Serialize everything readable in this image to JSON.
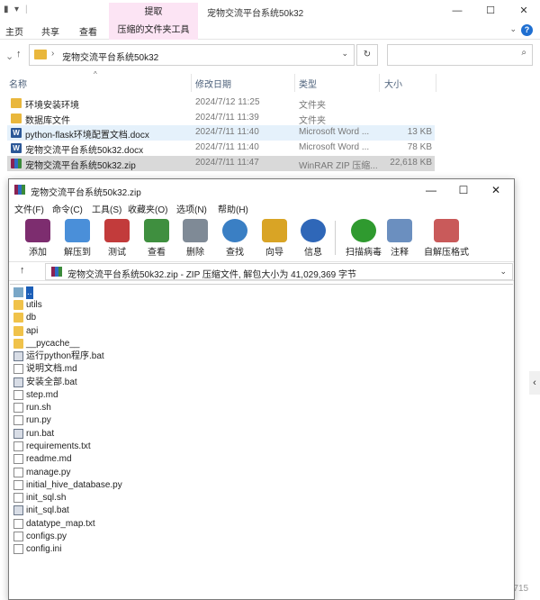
{
  "explorer": {
    "title": "宠物交流平台系统50k32",
    "context_tab_top": "提取",
    "ribbon_tabs": [
      "主页",
      "共享",
      "查看"
    ],
    "context_tab": "压缩的文件夹工具",
    "address_path": "宠物交流平台系统50k32",
    "columns": {
      "name": "名称",
      "date": "修改日期",
      "type": "类型",
      "size": "大小"
    },
    "files": [
      {
        "name": "环境安装环境",
        "date": "2024/7/12 11:25",
        "type": "文件夹",
        "size": "",
        "icon": "folder-icon"
      },
      {
        "name": "数据库文件",
        "date": "2024/7/11 11:39",
        "type": "文件夹",
        "size": "",
        "icon": "folder-icon"
      },
      {
        "name": "python-flask环境配置文档.docx",
        "date": "2024/7/11 11:40",
        "type": "Microsoft Word ...",
        "size": "13 KB",
        "icon": "word-doc-icon"
      },
      {
        "name": "宠物交流平台系统50k32.docx",
        "date": "2024/7/11 11:40",
        "type": "Microsoft Word ...",
        "size": "78 KB",
        "icon": "word-doc-icon"
      },
      {
        "name": "宠物交流平台系统50k32.zip",
        "date": "2024/7/11 11:47",
        "type": "WinRAR ZIP 压缩...",
        "size": "22,618 KB",
        "icon": "zip-archive-icon"
      }
    ]
  },
  "winrar": {
    "title": "宠物交流平台系统50k32.zip",
    "menu": [
      "文件(F)",
      "命令(C)",
      "工具(S)",
      "收藏夹(O)",
      "选项(N)",
      "帮助(H)"
    ],
    "toolbar": [
      {
        "label": "添加",
        "icon": "add-archive-icon",
        "color": "#7d2d6f"
      },
      {
        "label": "解压到",
        "icon": "extract-folder-icon",
        "color": "#4a8fd9"
      },
      {
        "label": "测试",
        "icon": "test-clipboard-icon",
        "color": "#c23b3b"
      },
      {
        "label": "查看",
        "icon": "view-book-icon",
        "color": "#3f8f3f"
      },
      {
        "label": "删除",
        "icon": "trash-icon",
        "color": "#7f8a96"
      },
      {
        "label": "查找",
        "icon": "find-magnifier-icon",
        "color": "#3a7fc4"
      },
      {
        "label": "向导",
        "icon": "wizard-wand-icon",
        "color": "#d9a425"
      },
      {
        "label": "信息",
        "icon": "info-icon",
        "color": "#2f67b8"
      },
      {
        "label": "扫描病毒",
        "icon": "virus-scan-icon",
        "color": "#2f9a2f"
      },
      {
        "label": "注释",
        "icon": "comment-icon",
        "color": "#6b8fbf"
      },
      {
        "label": "自解压格式",
        "icon": "sfx-archive-icon",
        "color": "#c95a5a"
      }
    ],
    "path_text": "宠物交流平台系统50k32.zip - ZIP 压缩文件, 解包大小为 41,029,369 字节",
    "entries": [
      {
        "name": "..",
        "kind": "up"
      },
      {
        "name": "utils",
        "kind": "folder"
      },
      {
        "name": "db",
        "kind": "folder"
      },
      {
        "name": "api",
        "kind": "folder"
      },
      {
        "name": "__pycache__",
        "kind": "folder"
      },
      {
        "name": "运行python程序.bat",
        "kind": "bat"
      },
      {
        "name": "说明文档.md",
        "kind": "file"
      },
      {
        "name": "安装全部.bat",
        "kind": "bat"
      },
      {
        "name": "step.md",
        "kind": "file"
      },
      {
        "name": "run.sh",
        "kind": "file"
      },
      {
        "name": "run.py",
        "kind": "file"
      },
      {
        "name": "run.bat",
        "kind": "bat"
      },
      {
        "name": "requirements.txt",
        "kind": "file"
      },
      {
        "name": "readme.md",
        "kind": "file"
      },
      {
        "name": "manage.py",
        "kind": "file"
      },
      {
        "name": "initial_hive_database.py",
        "kind": "file"
      },
      {
        "name": "init_sql.sh",
        "kind": "file"
      },
      {
        "name": "init_sql.bat",
        "kind": "bat"
      },
      {
        "name": "datatype_map.txt",
        "kind": "file"
      },
      {
        "name": "configs.py",
        "kind": "file"
      },
      {
        "name": "config.ini",
        "kind": "file"
      }
    ]
  },
  "watermark": "CSDN @shey715"
}
